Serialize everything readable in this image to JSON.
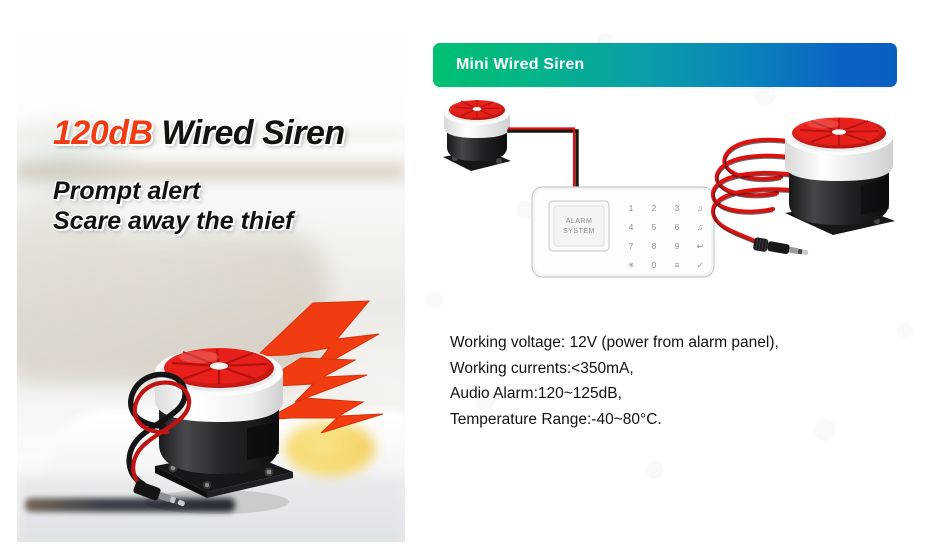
{
  "hero": {
    "title_highlight": "120dB",
    "title_rest": " Wired Siren",
    "subtitle_line1": "Prompt alert",
    "subtitle_line2": "Scare away the thief",
    "highlight_color": "#f13c13",
    "text_color": "#15110f"
  },
  "panel": {
    "header_title": "Mini Wired Siren",
    "header_gradient_from": "#00c070",
    "header_gradient_to": "#0a5ec2"
  },
  "diagram": {
    "keypad_display_line1": "ALARM",
    "keypad_display_line2": "SYSTEM",
    "keys": [
      "1",
      "2",
      "3",
      "♫",
      "4",
      "5",
      "6",
      "♫",
      "7",
      "8",
      "9",
      "↩",
      "✳",
      "0",
      "≡",
      "✓"
    ],
    "wire_color": "#e01010",
    "siren_red": "#e8201c",
    "siren_black": "#1c1c1e"
  },
  "specs": {
    "lines": [
      "Working voltage: 12V (power from alarm panel),",
      "Working currents:<350mA,",
      "Audio Alarm:120~125dB,",
      "Temperature Range:-40~80°C."
    ]
  }
}
